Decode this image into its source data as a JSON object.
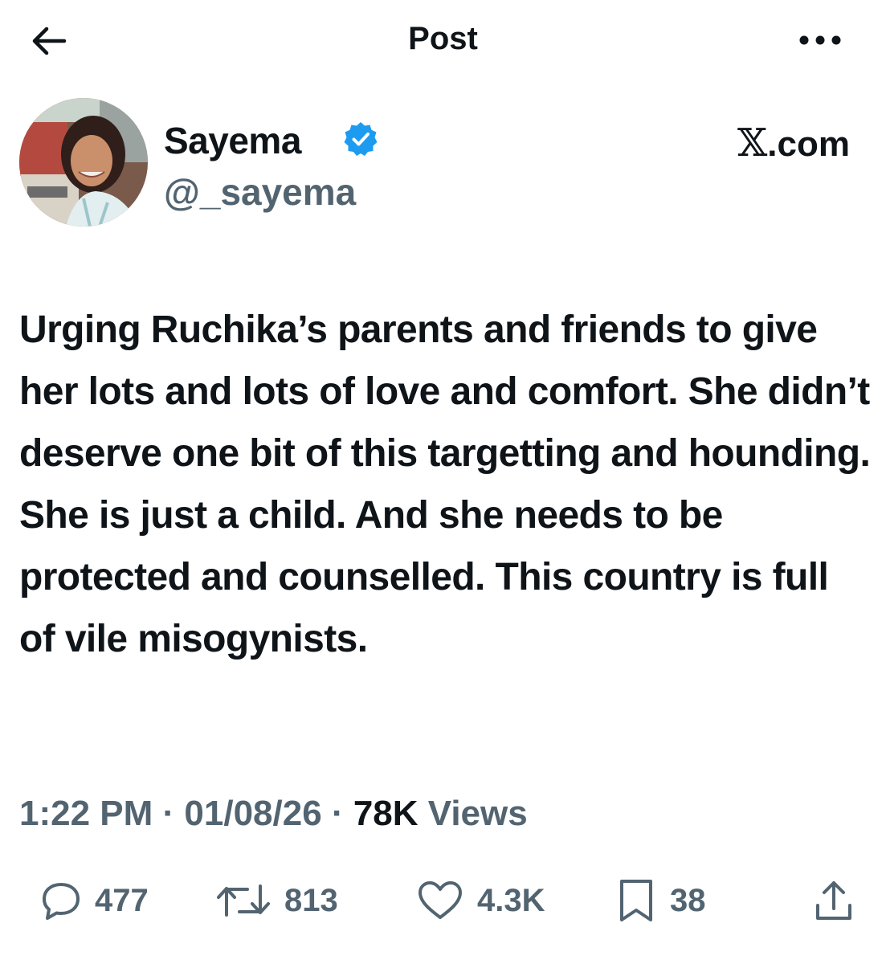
{
  "header": {
    "title": "Post",
    "back_icon": "arrow-left-icon",
    "more_icon": "more-horizontal-icon"
  },
  "author": {
    "display_name": "Sayema",
    "handle": "@_sayema",
    "verified": true,
    "verified_color": "#1d9bf0",
    "source_glyph": "𝕏",
    "source_label": ".com"
  },
  "post": {
    "text": "Urging Ruchika’s parents and friends to give her lots and lots of love and comfort. She didn’t deserve one bit of this targetting and hounding. She is just a child. And she needs to be protected and counselled. This country is full of vile misogynists."
  },
  "meta": {
    "time": "1:22 PM",
    "separator": "·",
    "date": "01/08/26",
    "views_count": "78K",
    "views_label": "Views"
  },
  "actions": {
    "replies": {
      "icon": "reply-icon",
      "count": "477"
    },
    "reposts": {
      "icon": "repost-icon",
      "count": "813"
    },
    "likes": {
      "icon": "heart-icon",
      "count": "4.3K"
    },
    "bookmarks": {
      "icon": "bookmark-icon",
      "count": "38"
    },
    "share": {
      "icon": "share-icon"
    }
  },
  "colors": {
    "text_primary": "#0f1419",
    "text_secondary": "#536471",
    "accent": "#1d9bf0"
  }
}
